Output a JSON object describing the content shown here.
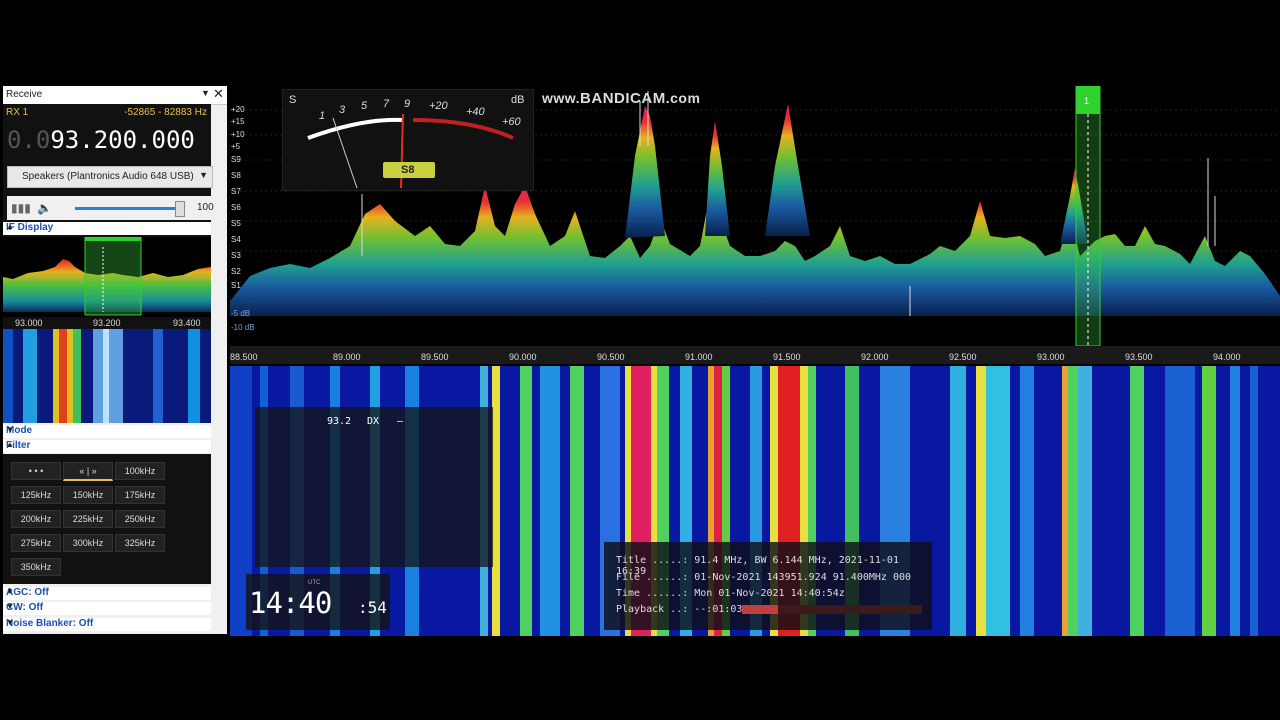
{
  "left_panel": {
    "title": "Receive",
    "rx": {
      "label": "RX 1",
      "range": "-52865 - 82883 Hz"
    },
    "frequency": {
      "dim": "0.0",
      "main": "93.200.000"
    },
    "audio": {
      "device": "Speakers (Plantronics Audio 648 USB)",
      "volume": 100,
      "volume_fraction": 0.96
    },
    "if_display": {
      "title": "IF Display",
      "ticks": [
        "93.000",
        "93.200",
        "93.400"
      ]
    },
    "mode": {
      "title": "Mode"
    },
    "filter": {
      "title": "Filter",
      "buttons": [
        "• • •",
        "« | »",
        "100kHz",
        "125kHz",
        "150kHz",
        "175kHz",
        "200kHz",
        "225kHz",
        "250kHz",
        "275kHz",
        "300kHz",
        "325kHz",
        "350kHz"
      ],
      "selected": "« | »"
    },
    "agc": "AGC: Off",
    "cw": "CW: Off",
    "noise_blanker": "Noise Blanker: Off"
  },
  "spectrum": {
    "s_labels": [
      "+20",
      "+15",
      "+10",
      "+5",
      "S9",
      "S8",
      "S7",
      "S6",
      "S5",
      "S4",
      "S3",
      "S2",
      "S1"
    ],
    "db_labels": [
      "-5 dB",
      "-10 dB"
    ],
    "freq_labels": [
      "88.500",
      "89.000",
      "89.500",
      "90.000",
      "90.500",
      "91.000",
      "91.500",
      "92.000",
      "92.500",
      "93.000",
      "93.500",
      "94.000"
    ],
    "marker": "1",
    "watermark": {
      "prefix": "www.",
      "brand": "BANDICAM",
      "suffix": ".com"
    }
  },
  "smeter": {
    "s": "S",
    "db": "dB",
    "scale": [
      "1",
      "3",
      "5",
      "7",
      "9",
      "+20",
      "+40",
      "+60"
    ],
    "reading": "S8"
  },
  "waterfall": {
    "rds": {
      "freq": "93.2",
      "mode": "DX",
      "text": "–"
    },
    "clock": {
      "utc": "UTC",
      "hm": "14:40",
      "sec": ":54"
    },
    "info": {
      "title": "Title .....: 91.4 MHz, BW 6.144 MHz, 2021-11-01 16:39",
      "file": "File ......: 01-Nov-2021 143951.924 91.400MHz 000",
      "time": "Time ......: Mon 01-Nov-2021 14:40:54z",
      "playback": "Playback ..: --:01:03",
      "playback_fraction": 0.2
    }
  },
  "colors": {
    "accent": "#e8c04a",
    "link": "#1a4fb0",
    "marker": "#2fd12f",
    "playback": "#c04040"
  }
}
